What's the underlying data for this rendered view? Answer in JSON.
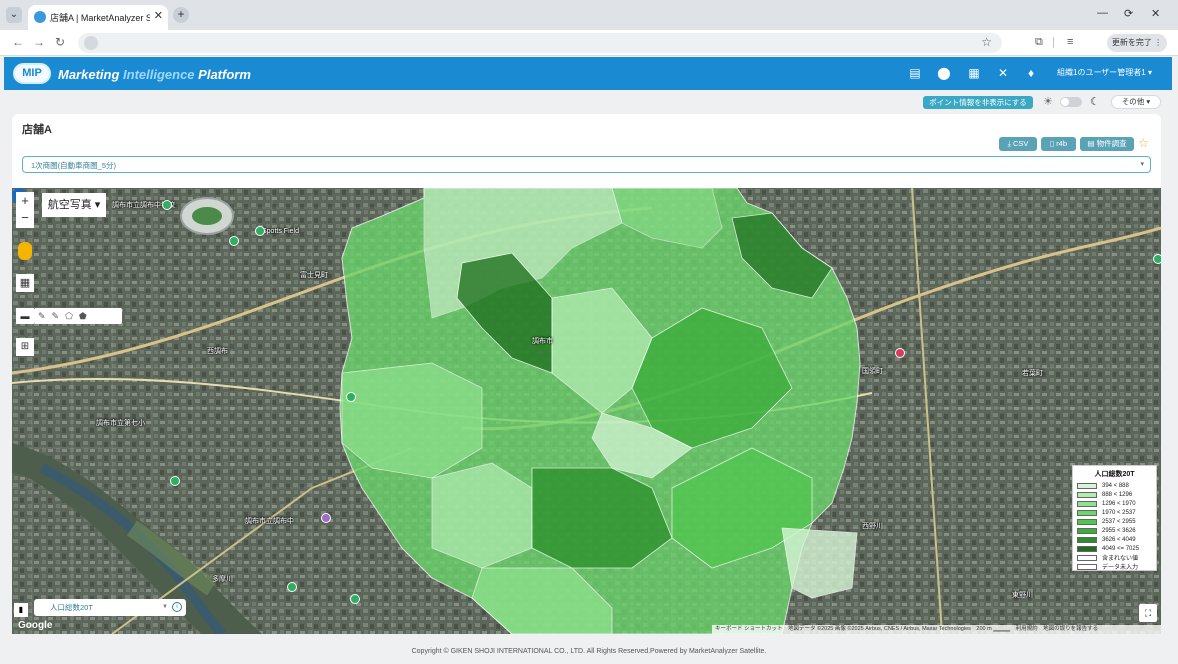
{
  "browser": {
    "tab_title": "店舗A | MarketAnalyzer Satellite",
    "tab_close": "✕",
    "new_tab": "+",
    "window_controls": [
      "—",
      "⟳",
      "✕"
    ],
    "update_button": "更新を完了 ⋮"
  },
  "header": {
    "logo_badge": "MIP",
    "logo_part1": "Marketing ",
    "logo_part2": "Intelligence ",
    "logo_part3": "Platform",
    "user_menu": "組織1のユーザー管理者1 ▾"
  },
  "toolbar": {
    "point_toggle": "ポイント情報を非表示にする",
    "other_menu": "その他 ▾"
  },
  "card": {
    "store_name": "店舗A",
    "csv_button": "CSV",
    "pdf_button": "r4b",
    "property_button": "物件調査",
    "area_select": "1次商圏(自動車商圏_5分)"
  },
  "map": {
    "map_type": "航空写真 ▾",
    "layer_select": "人口総数20T",
    "google": "Google",
    "attribution": "キーボード ショートカット　地図データ ©2025 画像 ©2025 Airbus, CNES / Airbus, Maxar Technologies　200 m ▁▁▁▁　利用規約　地図の誤りを報告する",
    "labels": [
      "調布市立調布中学校",
      "Spotts Field",
      "富士見町",
      "調布市",
      "西調布",
      "調布市立第七小",
      "調布市立調布中",
      "国領町",
      "若葉町",
      "多摩川",
      "東野川",
      "西野川"
    ]
  },
  "legend": {
    "title": "人口総数20T",
    "rows": [
      {
        "label": "394 < 888",
        "color": "#d6f5d6"
      },
      {
        "label": "888 < 1296",
        "color": "#b3edb3"
      },
      {
        "label": "1296 < 1970",
        "color": "#8fe38f"
      },
      {
        "label": "1970 < 2537",
        "color": "#6cd66c"
      },
      {
        "label": "2537 < 2955",
        "color": "#4fc74f"
      },
      {
        "label": "2955 < 3626",
        "color": "#3aad3a"
      },
      {
        "label": "3626 < 4049",
        "color": "#2a8f2a"
      },
      {
        "label": "4049 <= 7025",
        "color": "#1c6e1c"
      },
      {
        "label": "含まれない値",
        "color": "#ffffff"
      },
      {
        "label": "データ未入力",
        "color": "#ffffff"
      }
    ]
  },
  "footer": {
    "copyright": "Copyright © GIKEN SHOJI INTERNATIONAL CO., LTD. All Rights Reserved.Powered by MarketAnalyzer Satellite."
  },
  "colors": {
    "brand": "#1a8ad3",
    "accent": "#3aa8c4"
  }
}
